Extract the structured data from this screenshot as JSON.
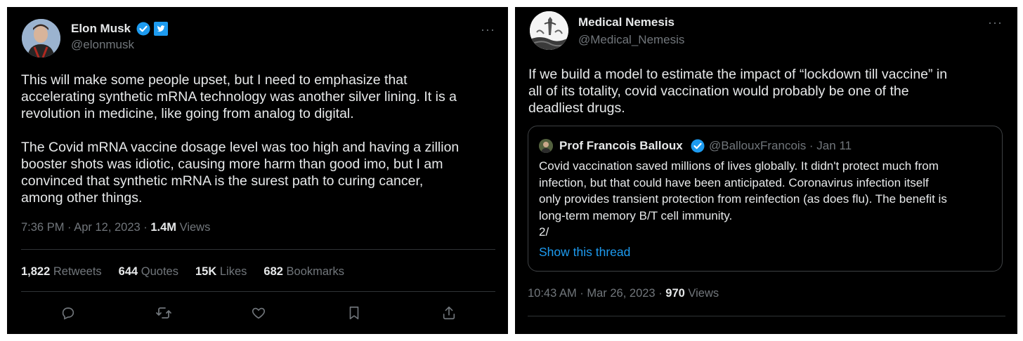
{
  "left_tweet": {
    "author_name": "Elon Musk",
    "author_handle": "@elonmusk",
    "more_label": "···",
    "text": "This will make some people upset, but I need to emphasize that\naccelerating synthetic mRNA technology was another silver lining. It is a\nrevolution in medicine, like going from analog to digital.\n\nThe Covid mRNA vaccine dosage level was too high and having a zillion\nbooster shots was idiotic, causing more harm than good imo, but I am\nconvinced that synthetic mRNA is the surest path to curing cancer,\namong other things.",
    "timestamp": "7:36 PM · Apr 12, 2023 · ",
    "views_count": "1.4M",
    "views_label": " Views",
    "stats": {
      "retweets_count": "1,822",
      "retweets_label": " Retweets",
      "quotes_count": "644",
      "quotes_label": " Quotes",
      "likes_count": "15K",
      "likes_label": " Likes",
      "bookmarks_count": "682",
      "bookmarks_label": " Bookmarks"
    },
    "icons": [
      "reply-icon",
      "retweet-icon",
      "like-icon",
      "bookmark-icon",
      "share-icon"
    ],
    "verified_color": "#1d9bf0"
  },
  "right_tweet": {
    "author_name": "Medical Nemesis",
    "author_handle": "@Medical_Nemesis",
    "more_label": "···",
    "text": "If we build a model to estimate the impact of “lockdown till vaccine” in\nall of its totality, covid vaccination would probably be one of the\ndeadliest drugs.",
    "quoted": {
      "author_name": "Prof Francois Balloux",
      "author_handle_date": "@BallouxFrancois · Jan 11",
      "text": "Covid vaccination saved millions of lives globally. It didn't protect much from\ninfection, but that could have been anticipated. Coronavirus infection itself\nonly provides transient protection from reinfection (as does flu). The benefit is\nlong-term memory B/T cell immunity.\n2/",
      "link": "Show this thread"
    },
    "timestamp": "10:43 AM · Mar 26, 2023 · ",
    "views_count": "970",
    "views_label": " Views",
    "link_color": "#1d9bf0"
  }
}
